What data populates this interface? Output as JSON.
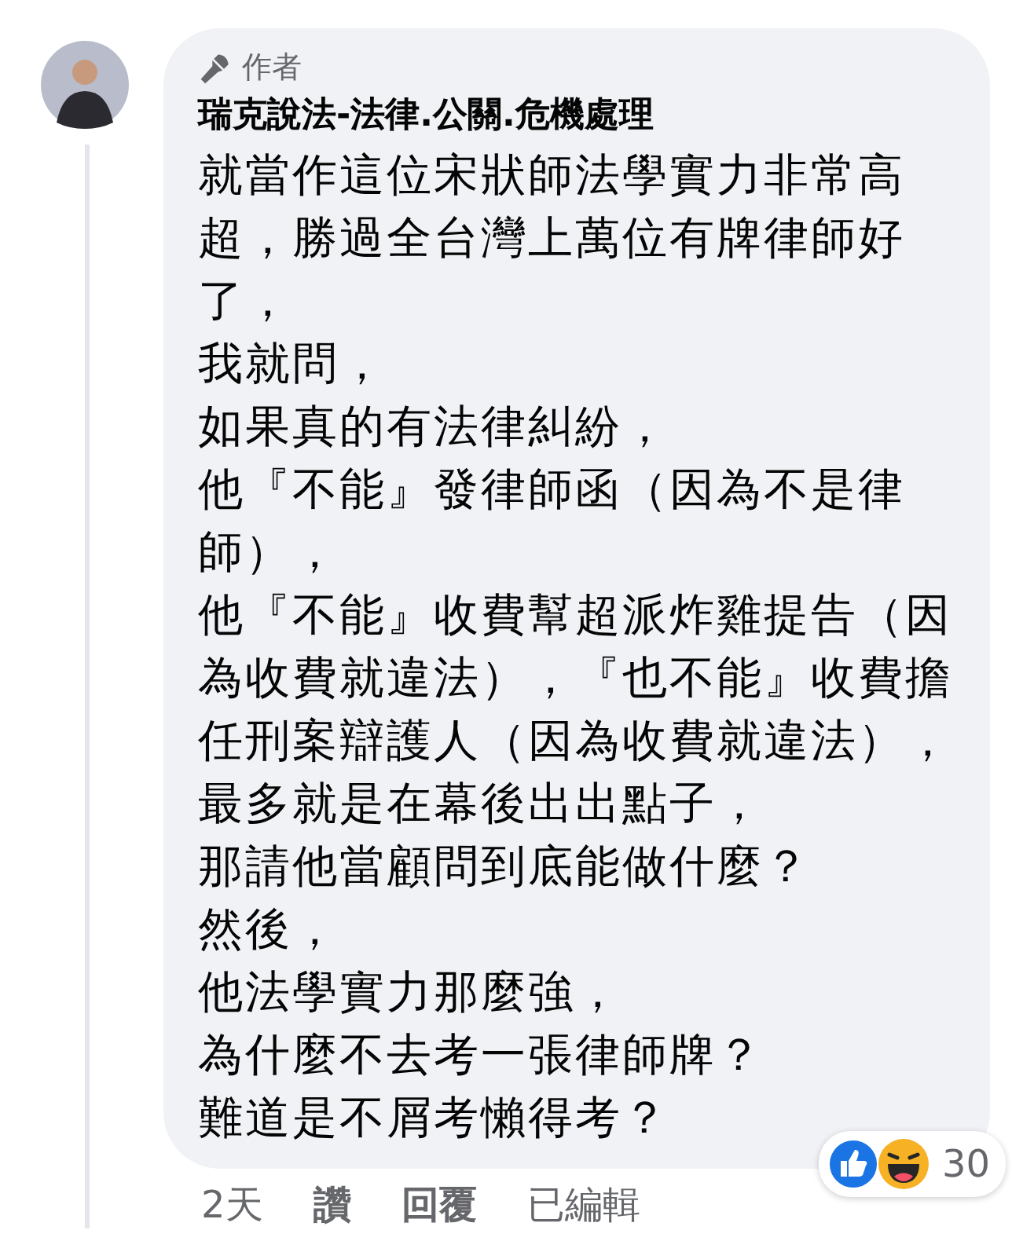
{
  "comment": {
    "author_badge": "作者",
    "author": "瑞克說法-法律.公關.危機處理",
    "body": [
      "就當作這位宋狀師法學實力非常高超，勝過全台灣上萬位有牌律師好了，",
      "我就問，",
      "如果真的有法律糾紛，",
      "他『不能』發律師函（因為不是律師），",
      "他『不能』收費幫超派炸雞提告（因為收費就違法），『也不能』收費擔任刑案辯護人（因為收費就違法），",
      "最多就是在幕後出出點子，",
      "那請他當顧問到底能做什麼？",
      "然後，",
      "他法學實力那麼強，",
      "為什麼不去考一張律師牌？",
      "難道是不屑考懶得考？"
    ],
    "reactions": {
      "count": "30"
    },
    "actions": [
      {
        "kind": "text",
        "text": "2天"
      },
      {
        "kind": "button",
        "text": "讚"
      },
      {
        "kind": "button",
        "text": "回覆"
      },
      {
        "kind": "text",
        "text": "已編輯"
      }
    ]
  }
}
